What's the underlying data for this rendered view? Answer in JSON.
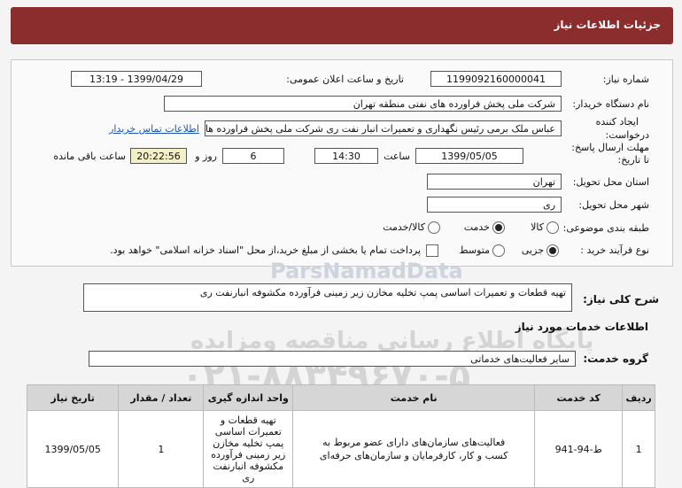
{
  "header": {
    "title": "جزئیات اطلاعات نیاز"
  },
  "form": {
    "need_number_label": "شماره نیاز:",
    "need_number": "1199092160000041",
    "announce_label": "تاریخ و ساعت اعلان عمومی:",
    "announce_value": "1399/04/29 - 13:19",
    "buyer_label": "نام دستگاه خریدار:",
    "buyer_value": "شرکت ملی پخش فراورده های نفتی منطقه تهران",
    "creator_label1": "ایجاد کننده",
    "creator_label2": "درخواست:",
    "creator_value": "عباس ملک برمی رئیس نگهداری و تعمیرات انبار نفت ری شرکت ملی پخش فراورده های نفتی",
    "contact_link": "اطلاعات تماس خریدار",
    "deadline_label1": "مهلت ارسال پاسخ:",
    "deadline_label2": "تا تاریخ:",
    "deadline_date": "1399/05/05",
    "time_label": "ساعت",
    "deadline_time": "14:30",
    "days_value": "6",
    "days_label": "روز و",
    "remaining_time": "20:22:56",
    "remaining_label": "ساعت باقی مانده",
    "province_label": "استان محل تحویل:",
    "province_value": "تهران",
    "city_label": "شهر محل تحویل:",
    "city_value": "ری",
    "category_label": "طبقه بندی موضوعی:",
    "category_options": [
      "کالا",
      "خدمت",
      "کالا/خدمت"
    ],
    "process_label": "نوع فرآیند خرید :",
    "process_options": [
      "جزیی",
      "متوسط"
    ],
    "payment_text": "پرداخت تمام یا بخشی از مبلغ خرید،از محل \"اسناد خزانه اسلامی\" خواهد بود."
  },
  "description": {
    "label": "شرح کلی نیاز:",
    "value": "تهیه قطعات و تعمیرات اساسی پمپ تخلیه مخازن زیر زمینی فرآورده مکشوفه انبارنفت ری"
  },
  "services": {
    "section_title": "اطلاعات خدمات مورد نیاز",
    "group_label": "گروه خدمت:",
    "group_value": "سایر فعالیت‌های خدماتی"
  },
  "table": {
    "headers": [
      "ردیف",
      "کد خدمت",
      "نام خدمت",
      "واحد اندازه گیری",
      "تعداد / مقدار",
      "تاریخ نیاز"
    ],
    "rows": [
      {
        "row": "1",
        "code": "ط-94-941",
        "name": "فعالیت‌های سازمان‌های دارای عضو مربوط به کسب و کار، کارفرمایان و سازمان‌های حرفه‌ای",
        "unit": "تهیه قطعات و تعمیرات اساسی پمپ تخلیه مخازن زیر زمینی فرآورده مکشوفه انبارنفت ری",
        "qty": "1",
        "date": "1399/05/05"
      }
    ]
  },
  "watermark": {
    "brand": "ParsNamadData",
    "tagline": "پایگاه اطلاع رسانی مناقصه ومزایده",
    "phone": "۰۲۱-۸۸۳۴۹۶۷۰-۵"
  }
}
